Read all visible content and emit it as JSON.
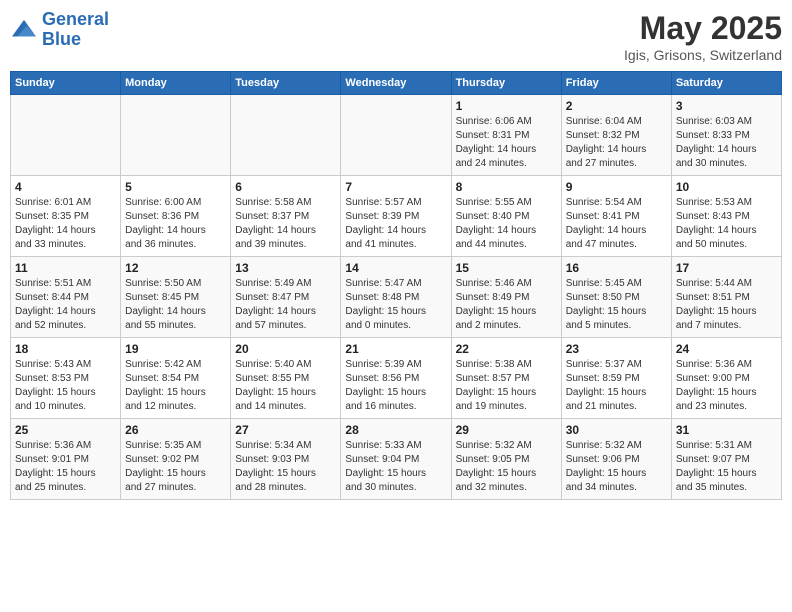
{
  "logo": {
    "line1": "General",
    "line2": "Blue"
  },
  "title": "May 2025",
  "subtitle": "Igis, Grisons, Switzerland",
  "headers": [
    "Sunday",
    "Monday",
    "Tuesday",
    "Wednesday",
    "Thursday",
    "Friday",
    "Saturday"
  ],
  "weeks": [
    [
      {
        "day": "",
        "info": ""
      },
      {
        "day": "",
        "info": ""
      },
      {
        "day": "",
        "info": ""
      },
      {
        "day": "",
        "info": ""
      },
      {
        "day": "1",
        "info": "Sunrise: 6:06 AM\nSunset: 8:31 PM\nDaylight: 14 hours\nand 24 minutes."
      },
      {
        "day": "2",
        "info": "Sunrise: 6:04 AM\nSunset: 8:32 PM\nDaylight: 14 hours\nand 27 minutes."
      },
      {
        "day": "3",
        "info": "Sunrise: 6:03 AM\nSunset: 8:33 PM\nDaylight: 14 hours\nand 30 minutes."
      }
    ],
    [
      {
        "day": "4",
        "info": "Sunrise: 6:01 AM\nSunset: 8:35 PM\nDaylight: 14 hours\nand 33 minutes."
      },
      {
        "day": "5",
        "info": "Sunrise: 6:00 AM\nSunset: 8:36 PM\nDaylight: 14 hours\nand 36 minutes."
      },
      {
        "day": "6",
        "info": "Sunrise: 5:58 AM\nSunset: 8:37 PM\nDaylight: 14 hours\nand 39 minutes."
      },
      {
        "day": "7",
        "info": "Sunrise: 5:57 AM\nSunset: 8:39 PM\nDaylight: 14 hours\nand 41 minutes."
      },
      {
        "day": "8",
        "info": "Sunrise: 5:55 AM\nSunset: 8:40 PM\nDaylight: 14 hours\nand 44 minutes."
      },
      {
        "day": "9",
        "info": "Sunrise: 5:54 AM\nSunset: 8:41 PM\nDaylight: 14 hours\nand 47 minutes."
      },
      {
        "day": "10",
        "info": "Sunrise: 5:53 AM\nSunset: 8:43 PM\nDaylight: 14 hours\nand 50 minutes."
      }
    ],
    [
      {
        "day": "11",
        "info": "Sunrise: 5:51 AM\nSunset: 8:44 PM\nDaylight: 14 hours\nand 52 minutes."
      },
      {
        "day": "12",
        "info": "Sunrise: 5:50 AM\nSunset: 8:45 PM\nDaylight: 14 hours\nand 55 minutes."
      },
      {
        "day": "13",
        "info": "Sunrise: 5:49 AM\nSunset: 8:47 PM\nDaylight: 14 hours\nand 57 minutes."
      },
      {
        "day": "14",
        "info": "Sunrise: 5:47 AM\nSunset: 8:48 PM\nDaylight: 15 hours\nand 0 minutes."
      },
      {
        "day": "15",
        "info": "Sunrise: 5:46 AM\nSunset: 8:49 PM\nDaylight: 15 hours\nand 2 minutes."
      },
      {
        "day": "16",
        "info": "Sunrise: 5:45 AM\nSunset: 8:50 PM\nDaylight: 15 hours\nand 5 minutes."
      },
      {
        "day": "17",
        "info": "Sunrise: 5:44 AM\nSunset: 8:51 PM\nDaylight: 15 hours\nand 7 minutes."
      }
    ],
    [
      {
        "day": "18",
        "info": "Sunrise: 5:43 AM\nSunset: 8:53 PM\nDaylight: 15 hours\nand 10 minutes."
      },
      {
        "day": "19",
        "info": "Sunrise: 5:42 AM\nSunset: 8:54 PM\nDaylight: 15 hours\nand 12 minutes."
      },
      {
        "day": "20",
        "info": "Sunrise: 5:40 AM\nSunset: 8:55 PM\nDaylight: 15 hours\nand 14 minutes."
      },
      {
        "day": "21",
        "info": "Sunrise: 5:39 AM\nSunset: 8:56 PM\nDaylight: 15 hours\nand 16 minutes."
      },
      {
        "day": "22",
        "info": "Sunrise: 5:38 AM\nSunset: 8:57 PM\nDaylight: 15 hours\nand 19 minutes."
      },
      {
        "day": "23",
        "info": "Sunrise: 5:37 AM\nSunset: 8:59 PM\nDaylight: 15 hours\nand 21 minutes."
      },
      {
        "day": "24",
        "info": "Sunrise: 5:36 AM\nSunset: 9:00 PM\nDaylight: 15 hours\nand 23 minutes."
      }
    ],
    [
      {
        "day": "25",
        "info": "Sunrise: 5:36 AM\nSunset: 9:01 PM\nDaylight: 15 hours\nand 25 minutes."
      },
      {
        "day": "26",
        "info": "Sunrise: 5:35 AM\nSunset: 9:02 PM\nDaylight: 15 hours\nand 27 minutes."
      },
      {
        "day": "27",
        "info": "Sunrise: 5:34 AM\nSunset: 9:03 PM\nDaylight: 15 hours\nand 28 minutes."
      },
      {
        "day": "28",
        "info": "Sunrise: 5:33 AM\nSunset: 9:04 PM\nDaylight: 15 hours\nand 30 minutes."
      },
      {
        "day": "29",
        "info": "Sunrise: 5:32 AM\nSunset: 9:05 PM\nDaylight: 15 hours\nand 32 minutes."
      },
      {
        "day": "30",
        "info": "Sunrise: 5:32 AM\nSunset: 9:06 PM\nDaylight: 15 hours\nand 34 minutes."
      },
      {
        "day": "31",
        "info": "Sunrise: 5:31 AM\nSunset: 9:07 PM\nDaylight: 15 hours\nand 35 minutes."
      }
    ]
  ]
}
